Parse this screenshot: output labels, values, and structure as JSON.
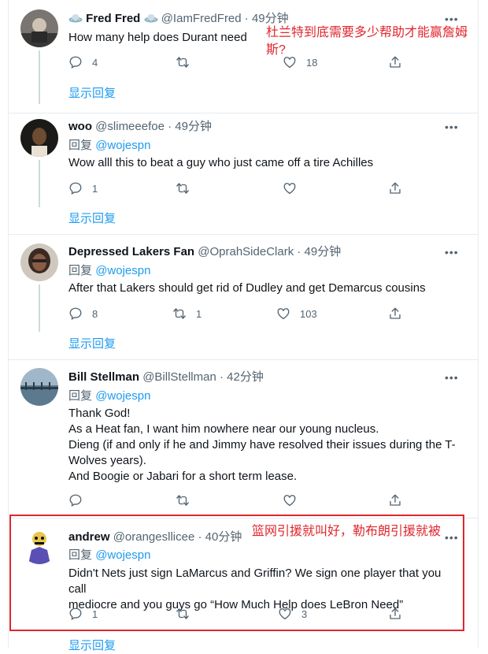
{
  "tweets": [
    {
      "name": "Fred Fred",
      "handle": "@IamFredFred",
      "time": "· 49分钟",
      "text": "How many help does Durant need",
      "replies": "4",
      "retweets": "",
      "likes": "18",
      "show_replies": "显示回复"
    },
    {
      "name": "woo",
      "handle": "@slimeeefoe",
      "time": "· 49分钟",
      "reply_label": "回复",
      "reply_mention": "@wojespn",
      "text": "Wow alll this to beat a guy who just came off a tire Achilles",
      "replies": "1",
      "retweets": "",
      "likes": "",
      "show_replies": "显示回复"
    },
    {
      "name": "Depressed Lakers Fan",
      "handle": "@OprahSideClark",
      "time": "· 49分钟",
      "reply_label": "回复",
      "reply_mention": "@wojespn",
      "text": "After that Lakers should get rid of Dudley and get Demarcus cousins",
      "replies": "8",
      "retweets": "1",
      "likes": "103",
      "show_replies": "显示回复"
    },
    {
      "name": "Bill Stellman",
      "handle": "@BillStellman",
      "time": "· 42分钟",
      "reply_label": "回复",
      "reply_mention": "@wojespn",
      "lines": [
        "Thank God!",
        "As a Heat fan, I want him nowhere near our young nucleus.",
        "Dieng (if and only if he and Jimmy have resolved their issues during the T-",
        "Wolves years).",
        "And Boogie or Jabari for a short term lease."
      ],
      "replies": "",
      "retweets": "",
      "likes": ""
    },
    {
      "name": "andrew",
      "handle": "@orangesllicee",
      "time": "· 40分钟",
      "reply_label": "回复",
      "reply_mention": "@wojespn",
      "lines": [
        "Didn't Nets just sign LaMarcus and Griffin? We sign one player that you call",
        "mediocre and you guys go “How Much Help does LeBron Need”"
      ],
      "replies": "1",
      "retweets": "",
      "likes": "3",
      "show_replies": "显示回复"
    }
  ],
  "annotations": {
    "note1_line1": "杜兰特到底需要多少帮助才能赢詹姆",
    "note1_line2": "斯?",
    "note2": "篮网引援就叫好，勒布朗引援就被"
  },
  "colors": {
    "accent": "#1d9bf0",
    "annotation": "#e0262d"
  }
}
